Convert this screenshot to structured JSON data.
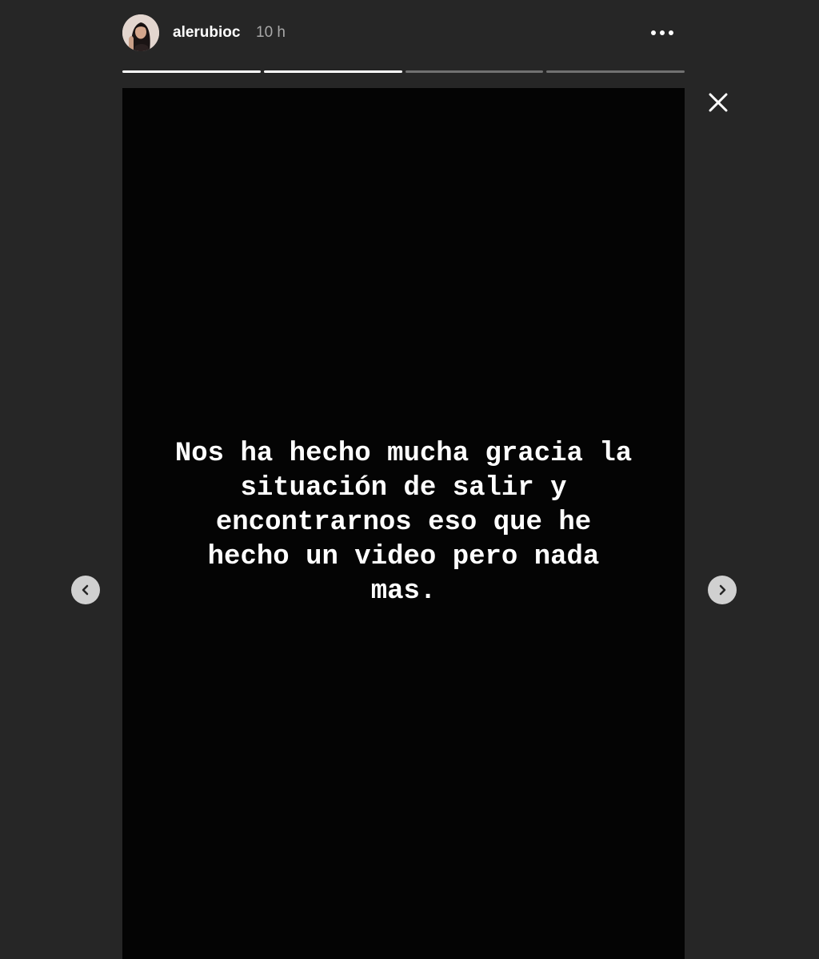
{
  "header": {
    "username": "alerubioc",
    "time_ago": "10 h",
    "avatar_icon": "user-avatar-photo",
    "more_icon": "more-options-icon"
  },
  "progress": [
    {
      "segment": 1,
      "progress": 1.0
    },
    {
      "segment": 2,
      "progress": 1.0
    },
    {
      "segment": 3,
      "progress": 0.0
    },
    {
      "segment": 4,
      "progress": 0.0
    }
  ],
  "story": {
    "lines": [
      "Nos ha hecho mucha gracia la",
      "situación de salir y",
      "encontrarnos eso que he",
      "hecho un video pero nada",
      "mas."
    ],
    "background_color": "#040404",
    "text_color": "#ffffff"
  },
  "controls": {
    "close_icon": "close-icon",
    "prev_icon": "chevron-left-icon",
    "next_icon": "chevron-right-icon"
  },
  "colors": {
    "page_background": "#262626",
    "time_text": "#a8a8a8",
    "progress_active": "#ffffff",
    "arrow_button": "#d0d0d0"
  }
}
